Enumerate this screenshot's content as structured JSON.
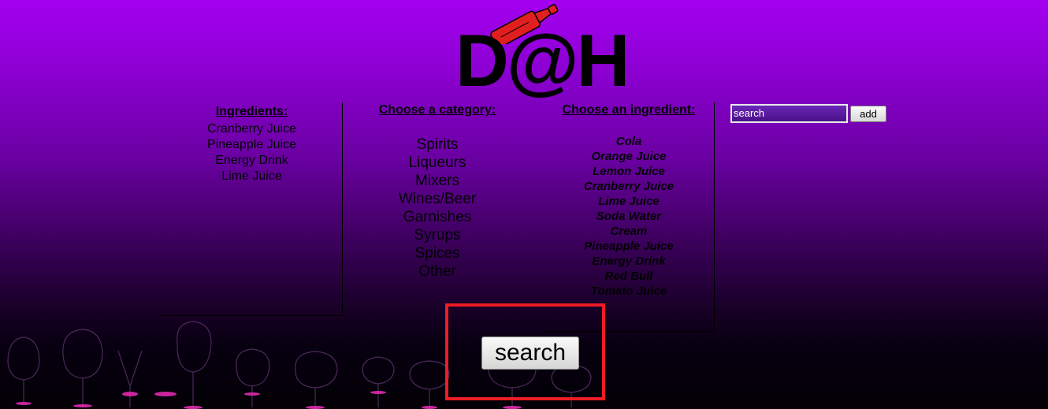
{
  "logo": {
    "text": "D@H",
    "icon": "bottle-icon"
  },
  "ingredients_panel": {
    "heading": "Ingredients:",
    "items": [
      "Cranberry Juice",
      "Pineapple Juice",
      "Energy Drink",
      "Lime Juice"
    ]
  },
  "category_panel": {
    "heading": "Choose a category:",
    "items": [
      "Spirits",
      "Liqueurs",
      "Mixers",
      "Wines/Beer",
      "Garnishes",
      "Syrups",
      "Spices",
      "Other"
    ]
  },
  "ingredient_panel": {
    "heading": "Choose an ingredient:",
    "items": [
      "Cola",
      "Orange Juice",
      "Lemon Juice",
      "Cranberry Juice",
      "Lime Juice",
      "Soda Water",
      "Cream",
      "Pineapple Juice",
      "Energy Drink",
      "Red Bull",
      "Tomato Juice"
    ]
  },
  "search_box": {
    "value": "search",
    "add_label": "add"
  },
  "main_search": {
    "label": "search"
  },
  "colors": {
    "accent_bottle": "#e11f1f",
    "highlight_box": "#ee1c24",
    "background_top": "#a400f0",
    "background_bottom": "#030006"
  }
}
